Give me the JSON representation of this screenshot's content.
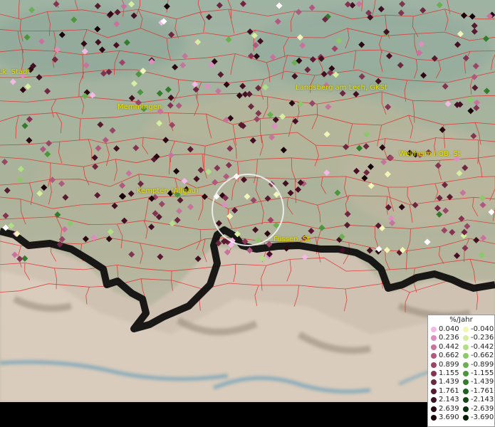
{
  "map": {
    "place_labels": [
      {
        "id": "stadt",
        "text": "(Lk. Stadt"
      },
      {
        "id": "memmingen",
        "text": "Memmingen"
      },
      {
        "id": "landsberg",
        "text": "Landsberg am Lech, GKSt"
      },
      {
        "id": "kempten",
        "text": "Kempten (Allgäu)"
      },
      {
        "id": "weilheim",
        "text": "Weilheim i.OB, St"
      },
      {
        "id": "fuessen",
        "text": "Füssen, St"
      }
    ]
  },
  "legend": {
    "title": "%/Jahr",
    "positive": [
      {
        "label": "0.040",
        "color": "#f2b8e6"
      },
      {
        "label": "0.236",
        "color": "#dc8ec0"
      },
      {
        "label": "0.442",
        "color": "#c8739e"
      },
      {
        "label": "0.662",
        "color": "#b0587f"
      },
      {
        "label": "0.899",
        "color": "#9a4467"
      },
      {
        "label": "1.155",
        "color": "#843452"
      },
      {
        "label": "1.439",
        "color": "#6e2641"
      },
      {
        "label": "1.761",
        "color": "#581a31"
      },
      {
        "label": "2.143",
        "color": "#421022"
      },
      {
        "label": "2.639",
        "color": "#2c0815"
      },
      {
        "label": "3.690",
        "color": "#18030a"
      }
    ],
    "negative": [
      {
        "label": "-0.040",
        "color": "#f2f5b8"
      },
      {
        "label": "-0.236",
        "color": "#d6eea0"
      },
      {
        "label": "-0.442",
        "color": "#b2de86"
      },
      {
        "label": "-0.662",
        "color": "#8cc86a"
      },
      {
        "label": "-0.899",
        "color": "#6aaf50"
      },
      {
        "label": "-1.155",
        "color": "#4b963c"
      },
      {
        "label": "-1.439",
        "color": "#327c2c"
      },
      {
        "label": "-1.761",
        "color": "#1f6220"
      },
      {
        "label": "-2.143",
        "color": "#114816"
      },
      {
        "label": "-2.639",
        "color": "#07300d"
      },
      {
        "label": "-3.690",
        "color": "#021a06"
      }
    ]
  }
}
